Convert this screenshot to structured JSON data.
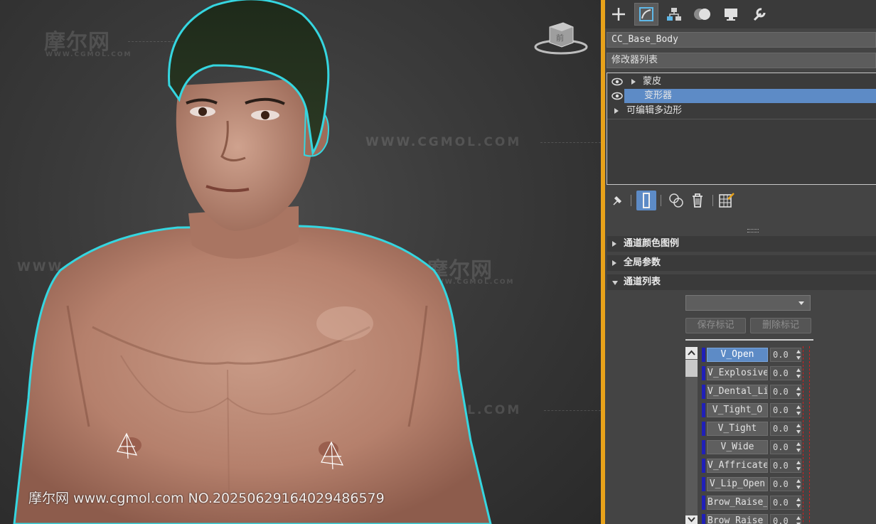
{
  "footer_watermark": "摩尔网 www.cgmol.com NO.20250629164029486579",
  "watermarks": {
    "logo": "摩尔网",
    "sub": "WWW.CGMOL.COM",
    "url": "WWW.CGMOL.COM"
  },
  "viewcube": {
    "face_label": "前"
  },
  "command_panel": {
    "tabs": [
      {
        "icon": "create-plus-icon"
      },
      {
        "icon": "modify-icon",
        "active": true
      },
      {
        "icon": "hierarchy-icon"
      },
      {
        "icon": "motion-icon"
      },
      {
        "icon": "display-icon"
      },
      {
        "icon": "utilities-wrench-icon"
      }
    ],
    "object_name": "CC_Base_Body",
    "modifier_list_label": "修改器列表",
    "stack": [
      {
        "label": "蒙皮",
        "eye": true,
        "expand": true,
        "selected": false
      },
      {
        "label": "变形器",
        "eye": true,
        "expand": false,
        "selected": true
      },
      {
        "label": "可编辑多边形",
        "eye": false,
        "expand": true,
        "selected": false
      }
    ],
    "rollouts": [
      {
        "label": "通道颜色图例",
        "expanded": false
      },
      {
        "label": "全局参数",
        "expanded": false
      },
      {
        "label": "通道列表",
        "expanded": true
      }
    ],
    "channel_list": {
      "dropdown_value": "",
      "save_marker_label": "保存标记",
      "delete_marker_label": "删除标记",
      "channels": [
        {
          "name": "V_Open",
          "value": "0.0",
          "active": true
        },
        {
          "name": "V_Explosive",
          "value": "0.0"
        },
        {
          "name": "V_Dental_Li",
          "value": "0.0"
        },
        {
          "name": "V_Tight_O",
          "value": "0.0"
        },
        {
          "name": "V_Tight",
          "value": "0.0"
        },
        {
          "name": "V_Wide",
          "value": "0.0"
        },
        {
          "name": "V_Affricate",
          "value": "0.0"
        },
        {
          "name": "V_Lip_Open",
          "value": "0.0"
        },
        {
          "name": "Brow_Raise_",
          "value": "0.0"
        },
        {
          "name": "Brow_Raise_",
          "value": "0.0"
        }
      ]
    }
  },
  "colors": {
    "accent_selection": "#5d8bc6",
    "viewport_divider": "#e8a21a",
    "selection_outline": "#35d6e0",
    "channel_bar": "#2020b8"
  }
}
